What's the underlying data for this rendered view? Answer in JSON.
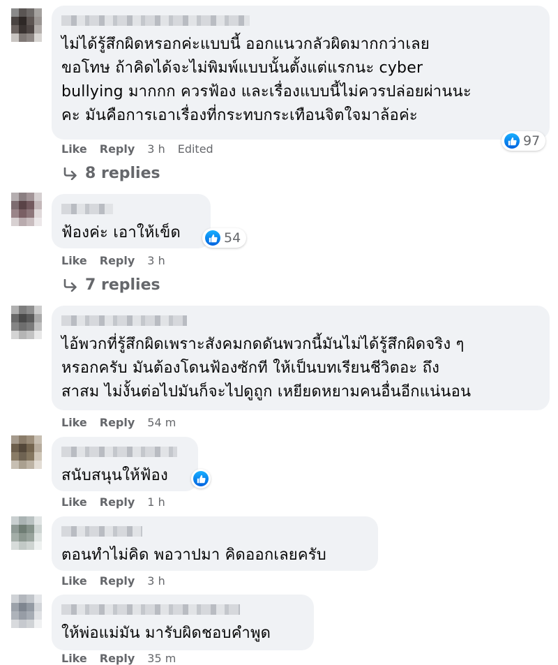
{
  "comments": [
    {
      "text": "ไม่ได้รู้สึกผิดหรอกค่ะแบบนี้ ออกแนวกลัวผิดมากกว่าเลย\nขอโทษ ถ้าคิดได้จะไม่พิมพ์แบบนั้นตั้งแต่แรกนะ cyber\nbullying มากกก ควรฟ้อง และเรื่องแบบนี้ไม่ควรปล่อยผ่านนะ\nคะ มันคือการเอาเรื่องที่กระทบกระเทือนจิตใจมาล้อค่ะ",
      "like": "Like",
      "reply": "Reply",
      "time": "3 h",
      "edited": "Edited",
      "reactions": "97",
      "replies": "8 replies"
    },
    {
      "text": "ฟ้องค่ะ เอาให้เข็ด",
      "like": "Like",
      "reply": "Reply",
      "time": "3 h",
      "reactions": "54",
      "replies": "7 replies"
    },
    {
      "text": "ไอ้พวกที่รู้สึกผิดเพราะสังคมกดดันพวกนี้มันไม่ได้รู้สึกผิดจริง ๆ\nหรอกครับ มันต้องโดนฟ้องซักที ให้เป็นบทเรียนชีวิตอะ ถึง\nสาสม ไม่งั้นต่อไปมันก็จะไปดูถูก เหยียดหยามคนอื่นอีกแน่นอน",
      "like": "Like",
      "reply": "Reply",
      "time": "54 m"
    },
    {
      "text": "สนับสนุนให้ฟ้อง",
      "like": "Like",
      "reply": "Reply",
      "time": "1 h"
    },
    {
      "text": "ตอนทำไม่คิด พอวาปมา คิดออกเลยครับ",
      "like": "Like",
      "reply": "Reply",
      "time": "3 h"
    },
    {
      "text": "ให้พ่อแม่มัน มารับผิดชอบคำพูด",
      "like": "Like",
      "reply": "Reply",
      "time": "35 m"
    }
  ],
  "colors": {
    "bubble": "#f0f2f5",
    "meta_text": "#65676b",
    "like_blue": "#1877f2"
  },
  "icons": [
    "like-icon",
    "reply-arrow-icon"
  ]
}
